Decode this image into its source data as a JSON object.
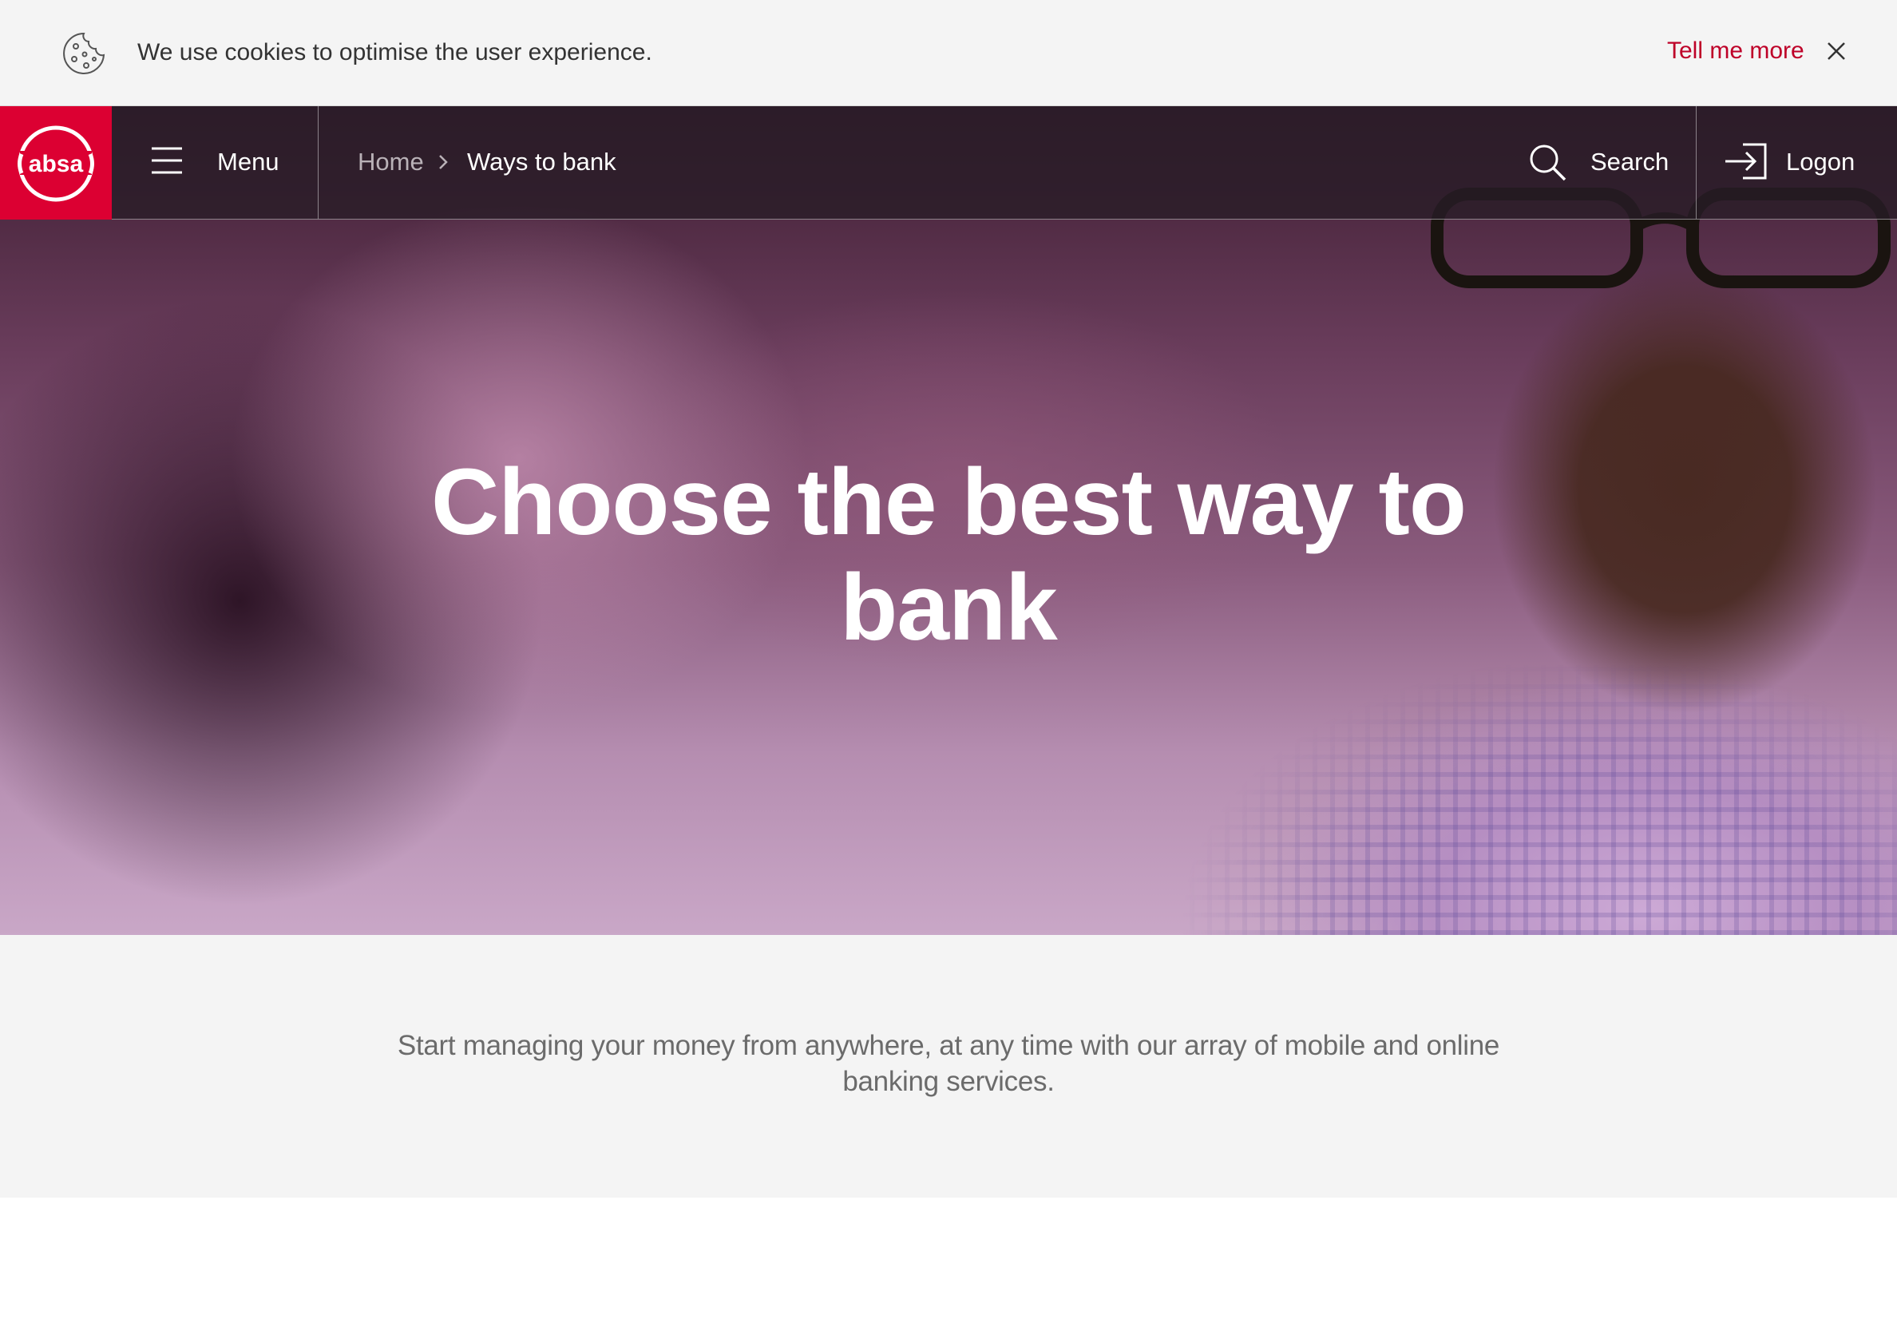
{
  "cookie_banner": {
    "message": "We use cookies to optimise the user experience.",
    "link_label": "Tell me more",
    "icon": "cookie-icon",
    "close_icon": "close-icon"
  },
  "header": {
    "logo_text": "absa",
    "menu_label": "Menu",
    "breadcrumb": {
      "home": "Home",
      "current": "Ways to bank"
    },
    "search_label": "Search",
    "logon_label": "Logon"
  },
  "hero": {
    "title": "Choose the best way to bank"
  },
  "intro": {
    "text": "Start managing your money from anywhere, at any time with our array of mobile and online banking services."
  },
  "colors": {
    "brand_red": "#dc0032",
    "link_red": "#be0028",
    "banner_bg": "#f4f4f4"
  }
}
